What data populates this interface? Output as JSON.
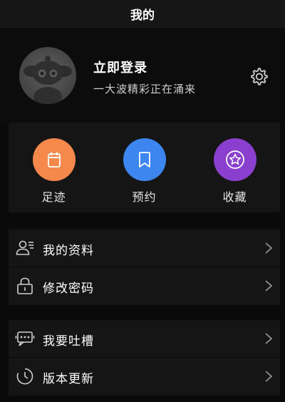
{
  "header": {
    "title": "我的"
  },
  "profile": {
    "name": "立即登录",
    "subtitle": "一大波精彩正在涌来",
    "avatar_icon": "default-avatar-icon",
    "settings_icon": "gear-icon"
  },
  "shortcuts": [
    {
      "label": "足迹",
      "icon": "footprint-icon",
      "color": "#f5884b"
    },
    {
      "label": "预约",
      "icon": "bookmark-icon",
      "color": "#3e86ef"
    },
    {
      "label": "收藏",
      "icon": "star-icon",
      "color": "#8b3fce"
    }
  ],
  "menu_group_1": [
    {
      "label": "我的资料",
      "icon": "profile-card-icon"
    },
    {
      "label": "修改密码",
      "icon": "lock-icon"
    }
  ],
  "menu_group_2": [
    {
      "label": "我要吐槽",
      "icon": "chat-bubble-icon"
    },
    {
      "label": "版本更新",
      "icon": "clock-icon"
    }
  ],
  "colors": {
    "background": "#0a0a0a",
    "panel": "#151515",
    "topbar": "#161616",
    "icon_line": "#cfcfcf"
  }
}
